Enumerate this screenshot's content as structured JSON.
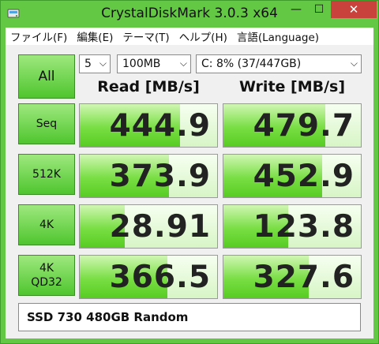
{
  "window": {
    "title": "CrystalDiskMark 3.0.3 x64",
    "minimize": "—",
    "maximize": "☐",
    "close": "✕"
  },
  "menu": {
    "items": [
      {
        "label": "ファイル(F)"
      },
      {
        "label": "編集(E)"
      },
      {
        "label": "テーマ(T)"
      },
      {
        "label": "ヘルプ(H)"
      },
      {
        "label": "言語(Language)"
      }
    ]
  },
  "controls": {
    "all_label": "All",
    "count": "5",
    "size": "100MB",
    "drive": "C: 8% (37/447GB)"
  },
  "columns": {
    "read": "Read [MB/s]",
    "write": "Write [MB/s]"
  },
  "rows": [
    {
      "label": "Seq",
      "label2": "",
      "read": "444.9",
      "write": "479.7",
      "read_fill": 0.73,
      "write_fill": 0.74
    },
    {
      "label": "512K",
      "label2": "",
      "read": "373.9",
      "write": "452.9",
      "read_fill": 0.65,
      "write_fill": 0.72
    },
    {
      "label": "4K",
      "label2": "",
      "read": "28.91",
      "write": "123.8",
      "read_fill": 0.33,
      "write_fill": 0.47
    },
    {
      "label": "4K",
      "label2": "QD32",
      "read": "366.5",
      "write": "327.6",
      "read_fill": 0.64,
      "write_fill": 0.62
    }
  ],
  "comment": "SSD 730 480GB Random",
  "colors": {
    "frame": "#63c843",
    "bar": "#79de44",
    "close": "#c9423b"
  }
}
